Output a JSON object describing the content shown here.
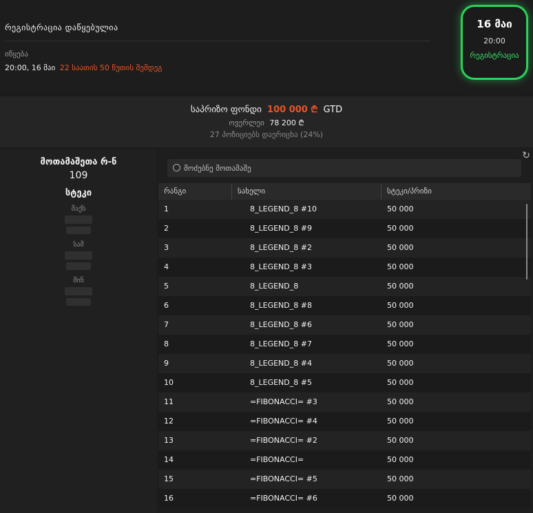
{
  "header": {
    "registration_title": "რეგისტრაცია დაწყებულია",
    "starts_label": "იწყება",
    "start_datetime": "20:00, 16 მაი",
    "countdown": "22 საათის 50 წუთის შემდეგ"
  },
  "badge": {
    "date": "16 მაი",
    "time": "20:00",
    "status": "რეგისტრაცია"
  },
  "prize": {
    "label": "საპრიზო ფონდი",
    "amount": "100 000 ₾",
    "gtd": "GTD",
    "overlay_label": "ოვერლეი",
    "overlay_amount": "78 200 ₾",
    "positions": "27 პოზიციებს დაერიცხა (24%)"
  },
  "stats": {
    "players_label": "მოთამაშეთა რ-ნ",
    "players_count": "109",
    "stack_title": "სტეკი",
    "max_label": "მაქს",
    "avg_label": "საშ",
    "min_label": "მინ"
  },
  "search": {
    "placeholder": "მოძებნე მოთამაშე"
  },
  "table": {
    "columns": [
      "რანგი",
      "სახელი",
      "სტეკი/პრიზი"
    ],
    "rows": [
      {
        "rank": "1",
        "name": "8_LEGEND_8 #10",
        "stack": "50 000"
      },
      {
        "rank": "2",
        "name": "8_LEGEND_8 #9",
        "stack": "50 000"
      },
      {
        "rank": "3",
        "name": "8_LEGEND_8 #2",
        "stack": "50 000"
      },
      {
        "rank": "4",
        "name": "8_LEGEND_8 #3",
        "stack": "50 000"
      },
      {
        "rank": "5",
        "name": "8_LEGEND_8",
        "stack": "50 000"
      },
      {
        "rank": "6",
        "name": "8_LEGEND_8 #8",
        "stack": "50 000"
      },
      {
        "rank": "7",
        "name": "8_LEGEND_8 #6",
        "stack": "50 000"
      },
      {
        "rank": "8",
        "name": "8_LEGEND_8 #7",
        "stack": "50 000"
      },
      {
        "rank": "9",
        "name": "8_LEGEND_8 #4",
        "stack": "50 000"
      },
      {
        "rank": "10",
        "name": "8_LEGEND_8 #5",
        "stack": "50 000"
      },
      {
        "rank": "11",
        "name": "=FIBONACCI= #3",
        "stack": "50 000"
      },
      {
        "rank": "12",
        "name": "=FIBONACCI= #4",
        "stack": "50 000"
      },
      {
        "rank": "13",
        "name": "=FIBONACCI= #2",
        "stack": "50 000"
      },
      {
        "rank": "14",
        "name": "=FIBONACCI=",
        "stack": "50 000"
      },
      {
        "rank": "15",
        "name": "=FIBONACCI= #5",
        "stack": "50 000"
      },
      {
        "rank": "16",
        "name": "=FIBONACCI= #6",
        "stack": "50 000"
      }
    ]
  },
  "colors": {
    "accent_orange": "#e8552a",
    "accent_green": "#2ad35a",
    "background": "#1c1c1c"
  },
  "icons": {
    "search": "search-icon",
    "refresh": "refresh-icon"
  }
}
